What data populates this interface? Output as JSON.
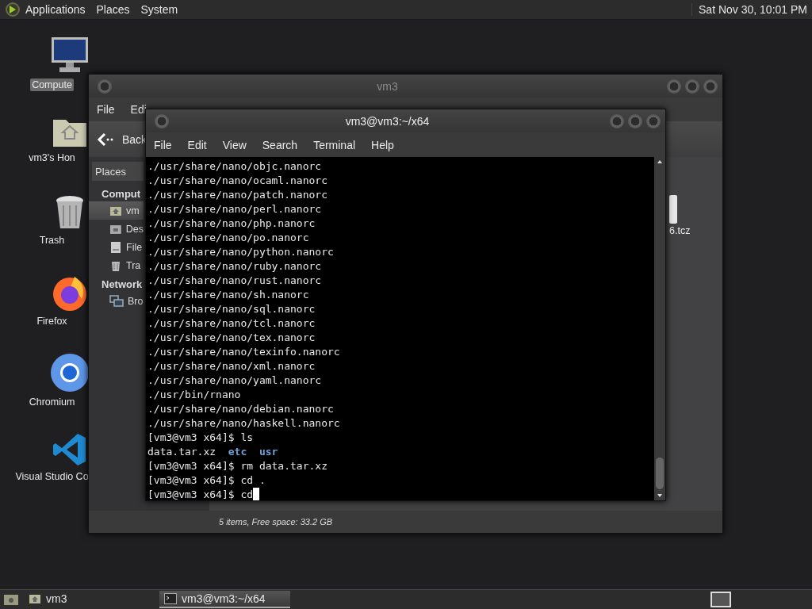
{
  "top_panel": {
    "menus": [
      "Applications",
      "Places",
      "System"
    ],
    "clock": "Sat Nov 30, 10:01 PM"
  },
  "desktop_icons": [
    {
      "kind": "computer",
      "label": "Compute",
      "selected": true
    },
    {
      "kind": "home",
      "label": "vm3's Hon",
      "selected": false
    },
    {
      "kind": "trash",
      "label": "Trash",
      "selected": false
    },
    {
      "kind": "firefox",
      "label": "Firefox",
      "selected": false
    },
    {
      "kind": "chromium",
      "label": "Chromium",
      "selected": false
    },
    {
      "kind": "vscode",
      "label": "Visual Studio Co",
      "selected": false
    }
  ],
  "file_manager": {
    "title": "vm3",
    "menus": [
      "File",
      "Edi"
    ],
    "back": "Back",
    "places": "Places",
    "sections": [
      {
        "title": "Comput",
        "items": [
          {
            "kind": "home",
            "label": "vm",
            "selected": true
          },
          {
            "kind": "desktop",
            "label": "Des",
            "selected": false
          },
          {
            "kind": "drive",
            "label": "File",
            "selected": false
          },
          {
            "kind": "trash",
            "label": "Tra",
            "selected": false
          }
        ]
      },
      {
        "title": "Network",
        "items": [
          {
            "kind": "network",
            "label": "Bro",
            "selected": false
          }
        ]
      }
    ],
    "files": [
      {
        "label": "6.tcz"
      }
    ],
    "status": "5 items, Free space: 33.2 GB"
  },
  "terminal": {
    "title": "vm3@vm3:~/x64",
    "menus": [
      "File",
      "Edit",
      "View",
      "Search",
      "Terminal",
      "Help"
    ],
    "lines": [
      {
        "kind": "text",
        "text": "./usr/share/nano/objc.nanorc"
      },
      {
        "kind": "text",
        "text": "./usr/share/nano/ocaml.nanorc"
      },
      {
        "kind": "text",
        "text": "./usr/share/nano/patch.nanorc"
      },
      {
        "kind": "text",
        "text": "./usr/share/nano/perl.nanorc"
      },
      {
        "kind": "text",
        "text": "./usr/share/nano/php.nanorc"
      },
      {
        "kind": "text",
        "text": "./usr/share/nano/po.nanorc"
      },
      {
        "kind": "text",
        "text": "./usr/share/nano/python.nanorc"
      },
      {
        "kind": "text",
        "text": "./usr/share/nano/ruby.nanorc"
      },
      {
        "kind": "text",
        "text": "./usr/share/nano/rust.nanorc"
      },
      {
        "kind": "text",
        "text": "./usr/share/nano/sh.nanorc"
      },
      {
        "kind": "text",
        "text": "./usr/share/nano/sql.nanorc"
      },
      {
        "kind": "text",
        "text": "./usr/share/nano/tcl.nanorc"
      },
      {
        "kind": "text",
        "text": "./usr/share/nano/tex.nanorc"
      },
      {
        "kind": "text",
        "text": "./usr/share/nano/texinfo.nanorc"
      },
      {
        "kind": "text",
        "text": "./usr/share/nano/xml.nanorc"
      },
      {
        "kind": "text",
        "text": "./usr/share/nano/yaml.nanorc"
      },
      {
        "kind": "text",
        "text": "./usr/bin/rnano"
      },
      {
        "kind": "text",
        "text": "./usr/share/nano/debian.nanorc"
      },
      {
        "kind": "text",
        "text": "./usr/share/nano/haskell.nanorc"
      },
      {
        "kind": "text",
        "text": "[vm3@vm3 x64]$ ls"
      },
      {
        "kind": "listing",
        "entries": [
          {
            "kind": "file",
            "name": "data.tar.xz"
          },
          {
            "kind": "directory",
            "name": "etc"
          },
          {
            "kind": "directory",
            "name": "usr"
          }
        ]
      },
      {
        "kind": "text",
        "text": "[vm3@vm3 x64]$ rm data.tar.xz"
      },
      {
        "kind": "text",
        "text": "[vm3@vm3 x64]$ cd ."
      },
      {
        "kind": "text",
        "text": "[vm3@vm3 x64]$ cd",
        "cursor": true
      }
    ]
  },
  "taskbar": {
    "tasks": [
      {
        "kind": "home",
        "label": "vm3",
        "selected": false
      },
      {
        "kind": "terminal",
        "label": "vm3@vm3:~/x64",
        "selected": true
      }
    ]
  }
}
